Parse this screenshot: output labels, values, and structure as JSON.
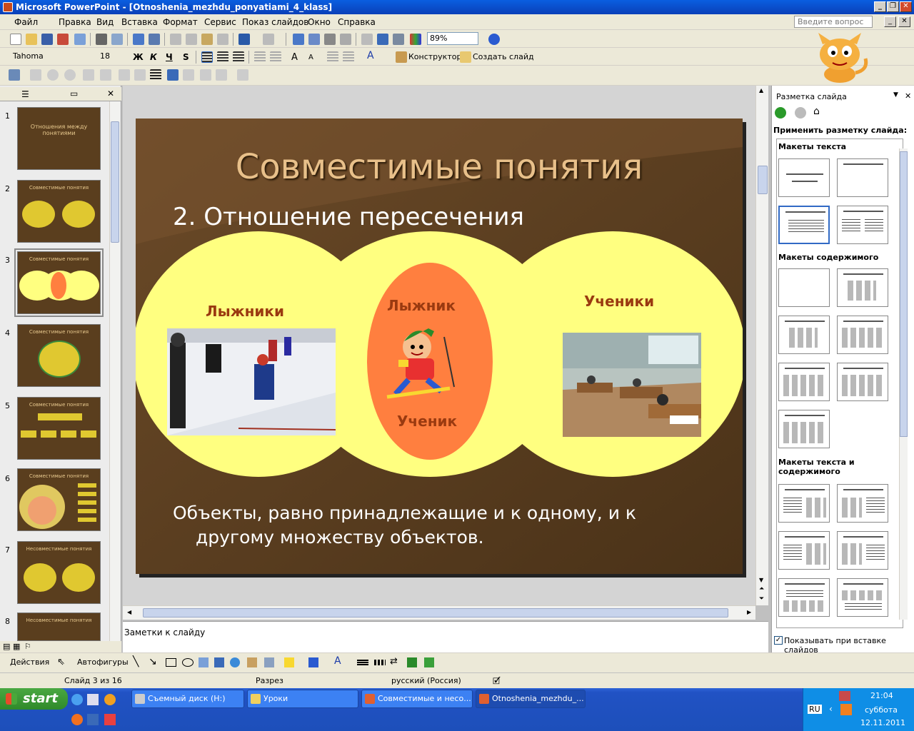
{
  "window": {
    "title": "Microsoft PowerPoint - [Otnoshenia_mezhdu_ponyatiami_4_klass]"
  },
  "menu": [
    "Файл",
    "Правка",
    "Вид",
    "Вставка",
    "Формат",
    "Сервис",
    "Показ слайдов",
    "Окно",
    "Справка"
  ],
  "ask_placeholder": "Введите вопрос",
  "toolbar": {
    "zoom": "89%",
    "font": "Tahoma",
    "font_size": "18",
    "bold": "Ж",
    "italic": "К",
    "underline": "Ч",
    "shadow": "S",
    "designer": "Конструктор",
    "new_slide": "Создать слайд"
  },
  "thumbnails": [
    {
      "num": "1",
      "title": "Отношения между понятиями"
    },
    {
      "num": "2",
      "title": "Совместимые понятия"
    },
    {
      "num": "3",
      "title": "Совместимые понятия"
    },
    {
      "num": "4",
      "title": "Совместимые понятия"
    },
    {
      "num": "5",
      "title": "Совместимые понятия"
    },
    {
      "num": "6",
      "title": "Совместимые понятия"
    },
    {
      "num": "7",
      "title": "Несовместимые понятия"
    },
    {
      "num": "8",
      "title": "Несовместимые понятия"
    }
  ],
  "slide": {
    "title": "Совместимые понятия",
    "subtitle": "2. Отношение пересечения",
    "left_label": "Лыжники",
    "center_top": "Лыжник",
    "center_bottom": "Ученик",
    "right_label": "Ученики",
    "body_line1": "Объекты, равно принадлежащие и к одному, и к",
    "body_line2": "другому множеству объектов."
  },
  "notes_placeholder": "Заметки к слайду",
  "taskpane": {
    "title": "Разметка слайда",
    "apply": "Применить разметку слайда:",
    "sections": [
      "Макеты текста",
      "Макеты содержимого",
      "Макеты текста и",
      "содержимого"
    ],
    "checkbox": "Показывать при вставке слайдов"
  },
  "drawbar": {
    "actions": "Действия",
    "autoshapes": "Автофигуры"
  },
  "status": {
    "slide": "Слайд 3 из 16",
    "design": "Разрез",
    "lang": "русский (Россия)"
  },
  "taskbar": {
    "start": "start",
    "items": [
      "Съемный диск (H:)",
      "Уроки",
      "Совместимые и несо...",
      "Otnoshenia_mezhdu_..."
    ],
    "lang": "RU",
    "time": "21:04",
    "day": "суббота",
    "date": "12.11.2011"
  },
  "colors": {
    "slide_bg": "#5a3e22",
    "circle": "#ffff80",
    "lens": "#ff7f3f",
    "title": "#e8c08a",
    "label": "#9a3a10"
  }
}
